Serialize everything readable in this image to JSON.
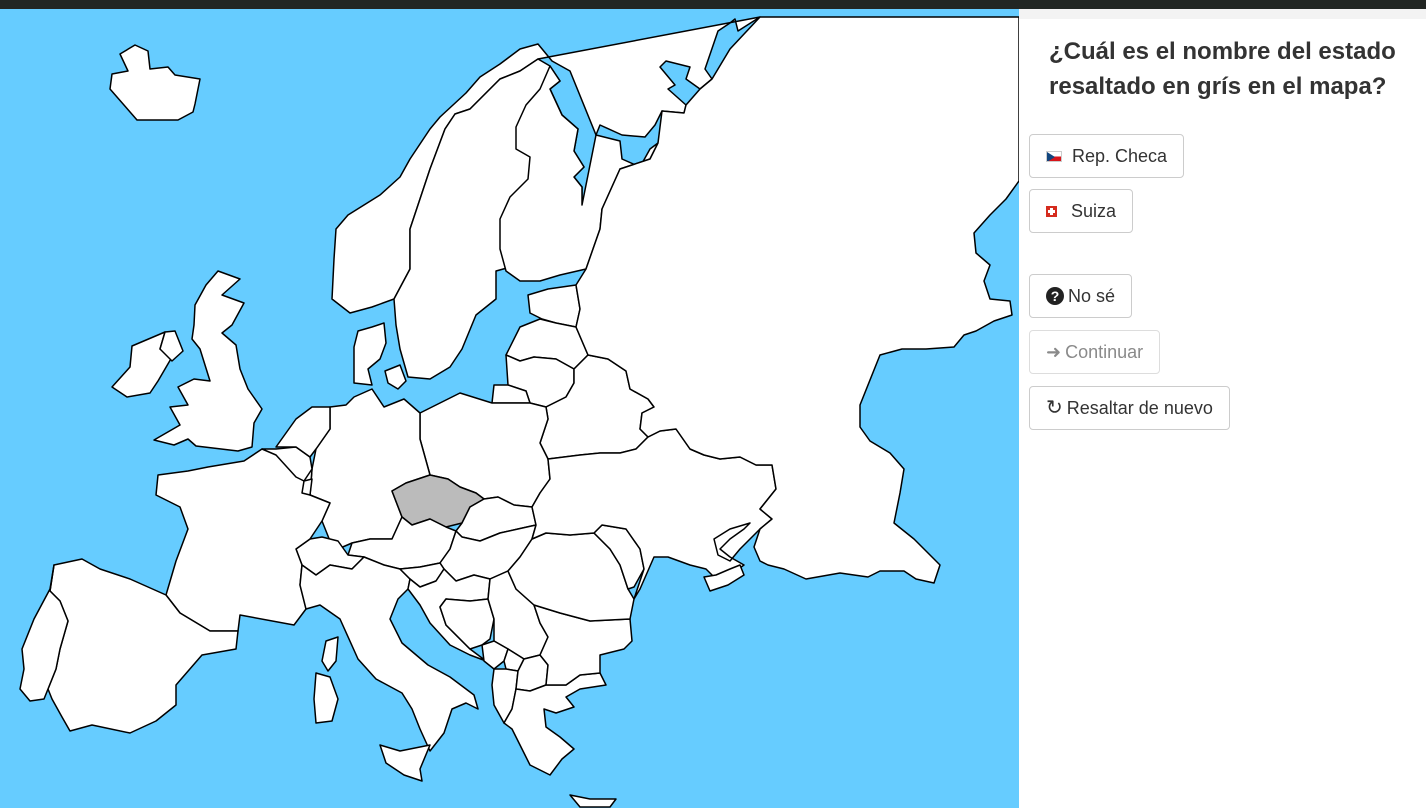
{
  "question": {
    "text": "¿Cuál es el nombre del estado resaltado en grís en el mapa?"
  },
  "options": [
    {
      "label": "Rep. Checa",
      "flag": "czech-flag"
    },
    {
      "label": "Suiza",
      "flag": "swiss-flag"
    }
  ],
  "actions": {
    "dont_know": {
      "label": "No sé",
      "icon": "question-circle-icon"
    },
    "continue": {
      "label": "Continuar",
      "icon": "arrow-right-icon",
      "disabled": true
    },
    "rehighlight": {
      "label": "Resaltar de nuevo",
      "icon": "refresh-icon"
    }
  },
  "map": {
    "highlighted_country": "Czech Republic",
    "colors": {
      "sea": "#66ccff",
      "land": "#ffffff",
      "highlight": "#bbbbbb",
      "border": "#000000"
    }
  }
}
